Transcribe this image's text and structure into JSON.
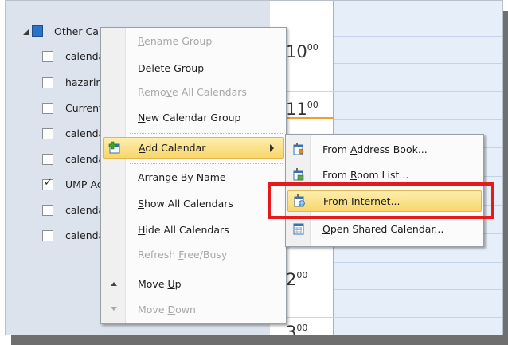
{
  "nav": {
    "group_label": "Other Calendars",
    "items": [
      {
        "label": "calendar",
        "checked": false
      },
      {
        "label": "hazarinet",
        "checked": false
      },
      {
        "label": "Current",
        "checked": false
      },
      {
        "label": "calendar",
        "checked": false
      },
      {
        "label": "calendar",
        "checked": false
      },
      {
        "label": "UMP Academic",
        "checked": true
      },
      {
        "label": "calendar",
        "checked": false
      },
      {
        "label": "calendar",
        "checked": false
      }
    ]
  },
  "calendar": {
    "hours": [
      {
        "hour": "10",
        "min": "00"
      },
      {
        "hour": "11",
        "min": "00"
      },
      {
        "hour": "2",
        "min": "00"
      },
      {
        "hour": "3",
        "min": "00"
      }
    ],
    "now_line_color": "#f0a028"
  },
  "context_menu": {
    "items": [
      {
        "pre": "",
        "u": "R",
        "post": "ename Group",
        "disabled": true
      },
      {
        "pre": "D",
        "u": "e",
        "post": "lete Group",
        "disabled": false
      },
      {
        "pre": "Remo",
        "u": "v",
        "post": "e All Calendars",
        "disabled": true
      },
      {
        "pre": "",
        "u": "N",
        "post": "ew Calendar Group",
        "disabled": false
      },
      {
        "pre": "",
        "u": "A",
        "post": "dd Calendar",
        "disabled": false,
        "icon": "add-calendar-icon",
        "submenu": true
      },
      {
        "pre": "",
        "u": "A",
        "post": "rrange By Name",
        "disabled": false
      },
      {
        "pre": "",
        "u": "S",
        "post": "how All Calendars",
        "disabled": false
      },
      {
        "pre": "",
        "u": "H",
        "post": "ide All Calendars",
        "disabled": false
      },
      {
        "pre": "Refresh ",
        "u": "F",
        "post": "ree/Busy",
        "disabled": true
      },
      {
        "pre": "Move ",
        "u": "U",
        "post": "p",
        "disabled": false,
        "icon": "arrow-up-icon"
      },
      {
        "pre": "Move ",
        "u": "D",
        "post": "own",
        "disabled": true,
        "icon": "arrow-down-icon"
      }
    ]
  },
  "submenu": {
    "items": [
      {
        "pre": "From ",
        "u": "A",
        "post": "ddress Book...",
        "icon": "address-book-icon"
      },
      {
        "pre": "From ",
        "u": "R",
        "post": "oom List...",
        "icon": "room-list-icon"
      },
      {
        "pre": "From ",
        "u": "I",
        "post": "nternet...",
        "icon": "internet-calendar-icon",
        "highlighted": true
      },
      {
        "pre": "",
        "u": "O",
        "post": "pen Shared Calendar...",
        "icon": "shared-calendar-icon"
      }
    ]
  },
  "colors": {
    "highlight": "#f7d66a",
    "annotation": "#e51a1a",
    "nav_background": "#dde3ec",
    "day_background": "#e6eef9"
  }
}
